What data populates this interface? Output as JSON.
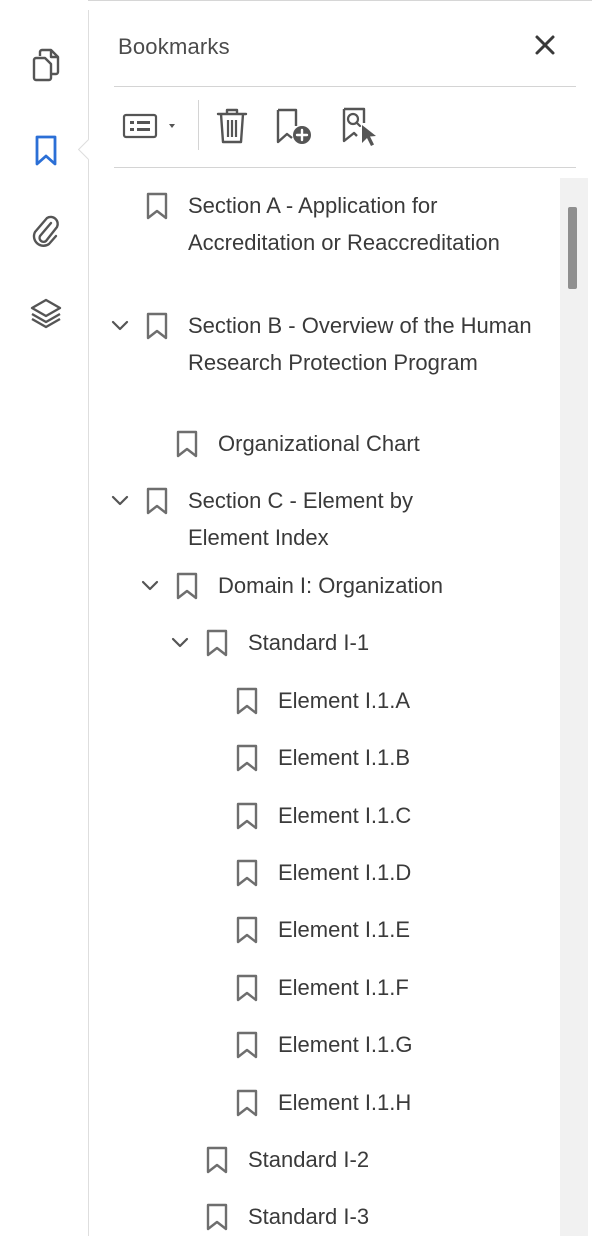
{
  "panel": {
    "title": "Bookmarks"
  },
  "rail": {
    "items": [
      {
        "icon": "page-thumbnails-icon",
        "active": false
      },
      {
        "icon": "bookmarks-icon",
        "active": true
      },
      {
        "icon": "attachments-icon",
        "active": false
      },
      {
        "icon": "layers-icon",
        "active": false
      }
    ]
  },
  "toolbar": {
    "options_icon": "options-list-icon",
    "delete_icon": "trash-icon",
    "new_bookmark_icon": "add-bookmark-icon",
    "find_bookmark_icon": "find-current-bookmark-icon"
  },
  "colors": {
    "accent": "#2b6fd6",
    "icon_gray": "#6e6e6e",
    "text": "#3a3a3a"
  },
  "bookmarks": [
    {
      "label": "Section A - Application for Accreditation or Reaccreditation",
      "expanded": null
    },
    {
      "label": "Section B - Overview of the Human Research Protection Program",
      "expanded": true
    },
    {
      "label": "Organizational Chart",
      "expanded": null
    },
    {
      "label": "Section C - Element by Element Index",
      "expanded": true
    },
    {
      "label": "Domain I: Organization",
      "expanded": true
    },
    {
      "label": "Standard I-1",
      "expanded": true
    },
    {
      "label": "Element I.1.A",
      "expanded": null
    },
    {
      "label": "Element I.1.B",
      "expanded": null
    },
    {
      "label": "Element I.1.C",
      "expanded": null
    },
    {
      "label": "Element I.1.D",
      "expanded": null
    },
    {
      "label": "Element I.1.E",
      "expanded": null
    },
    {
      "label": "Element I.1.F",
      "expanded": null
    },
    {
      "label": "Element I.1.G",
      "expanded": null
    },
    {
      "label": "Element I.1.H",
      "expanded": null
    },
    {
      "label": "Standard I-2",
      "expanded": null
    },
    {
      "label": "Standard I-3",
      "expanded": null
    }
  ]
}
